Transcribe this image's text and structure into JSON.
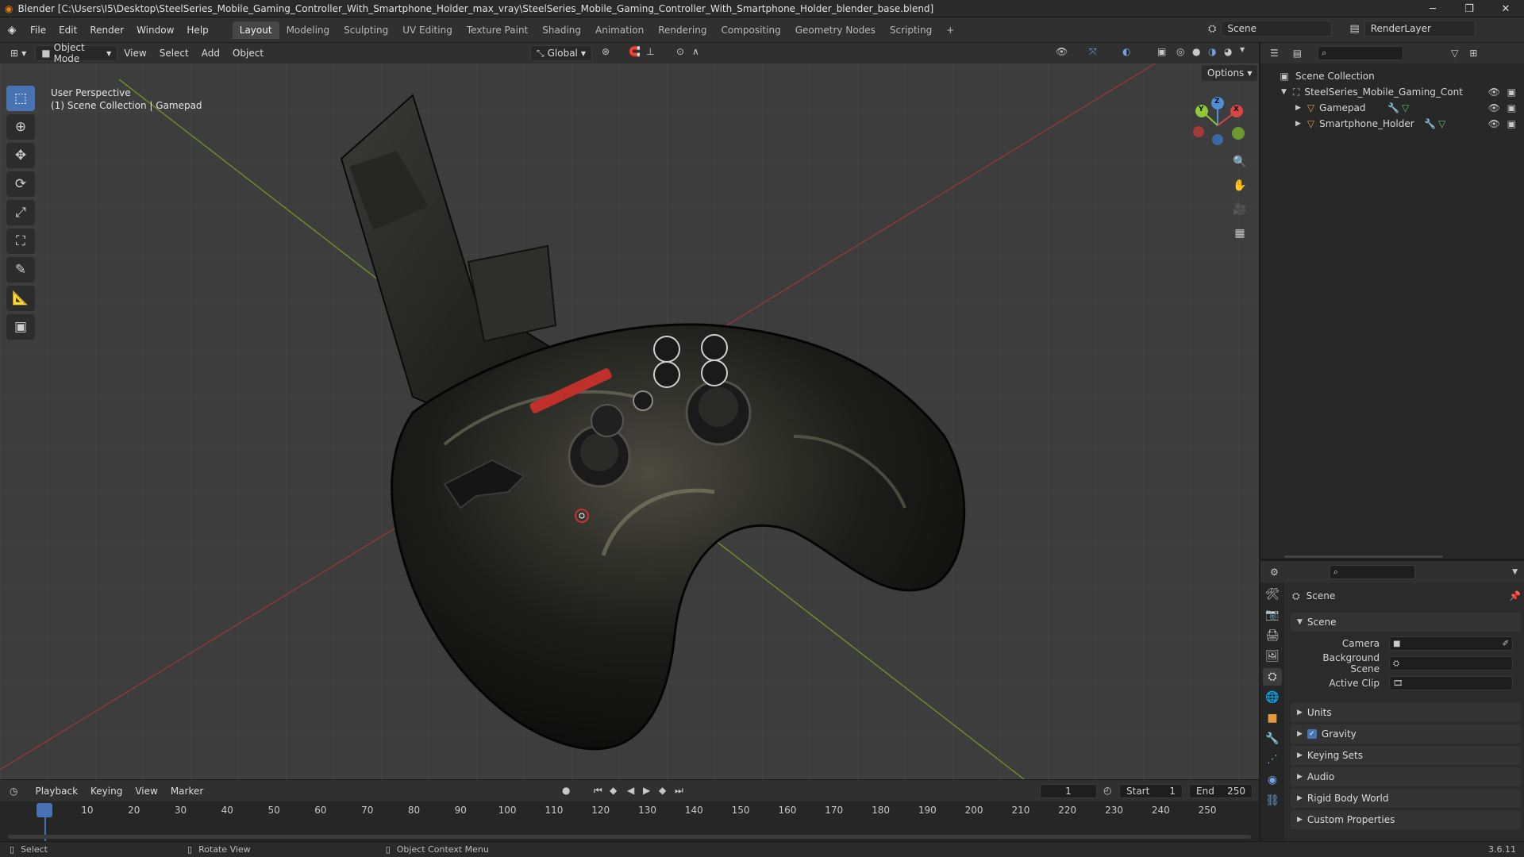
{
  "window": {
    "title": "Blender [C:\\Users\\I5\\Desktop\\SteelSeries_Mobile_Gaming_Controller_With_Smartphone_Holder_max_vray\\SteelSeries_Mobile_Gaming_Controller_With_Smartphone_Holder_blender_base.blend]",
    "minimize": "─",
    "maximize": "❐",
    "close": "✕"
  },
  "menu": {
    "items": [
      "File",
      "Edit",
      "Render",
      "Window",
      "Help"
    ],
    "workspaces": [
      "Layout",
      "Modeling",
      "Sculpting",
      "UV Editing",
      "Texture Paint",
      "Shading",
      "Animation",
      "Rendering",
      "Compositing",
      "Geometry Nodes",
      "Scripting"
    ],
    "active_workspace": "Layout",
    "add_workspace": "+",
    "scene_name": "Scene",
    "view_layer": "RenderLayer"
  },
  "viewport_header": {
    "mode": "Object Mode",
    "menus": [
      "View",
      "Select",
      "Add",
      "Object"
    ],
    "orientation": "Global",
    "options": "Options"
  },
  "viewport": {
    "perspective": "User Perspective",
    "collection_info": "(1) Scene Collection | Gamepad",
    "gizmo": {
      "x": "X",
      "y": "Y",
      "z": "Z"
    }
  },
  "tools": [
    "select-box-icon",
    "cursor-icon",
    "move-icon",
    "rotate-icon",
    "scale-icon",
    "transform-icon",
    "annotate-icon",
    "measure-icon",
    "add-cube-icon"
  ],
  "outliner": {
    "root": "Scene Collection",
    "collection": "SteelSeries_Mobile_Gaming_Controller_",
    "objects": [
      "Gamepad",
      "Smartphone_Holder"
    ]
  },
  "properties": {
    "context": "Scene",
    "panel_title": "Scene",
    "camera_label": "Camera",
    "background_label": "Background Scene",
    "clip_label": "Active Clip",
    "sections": [
      "Units",
      "Gravity",
      "Keying Sets",
      "Audio",
      "Rigid Body World",
      "Custom Properties"
    ],
    "gravity_checked": true
  },
  "timeline": {
    "menus": [
      "Playback",
      "Keying",
      "View",
      "Marker"
    ],
    "current_frame": "1",
    "start_label": "Start",
    "start": "1",
    "end_label": "End",
    "end": "250",
    "ticks": [
      "1",
      "10",
      "20",
      "30",
      "40",
      "50",
      "60",
      "70",
      "80",
      "90",
      "100",
      "110",
      "120",
      "130",
      "140",
      "150",
      "160",
      "170",
      "180",
      "190",
      "200",
      "210",
      "220",
      "230",
      "240",
      "250"
    ]
  },
  "statusbar": {
    "select": "Select",
    "rotate": "Rotate View",
    "context_menu": "Object Context Menu",
    "version": "3.6.11"
  }
}
